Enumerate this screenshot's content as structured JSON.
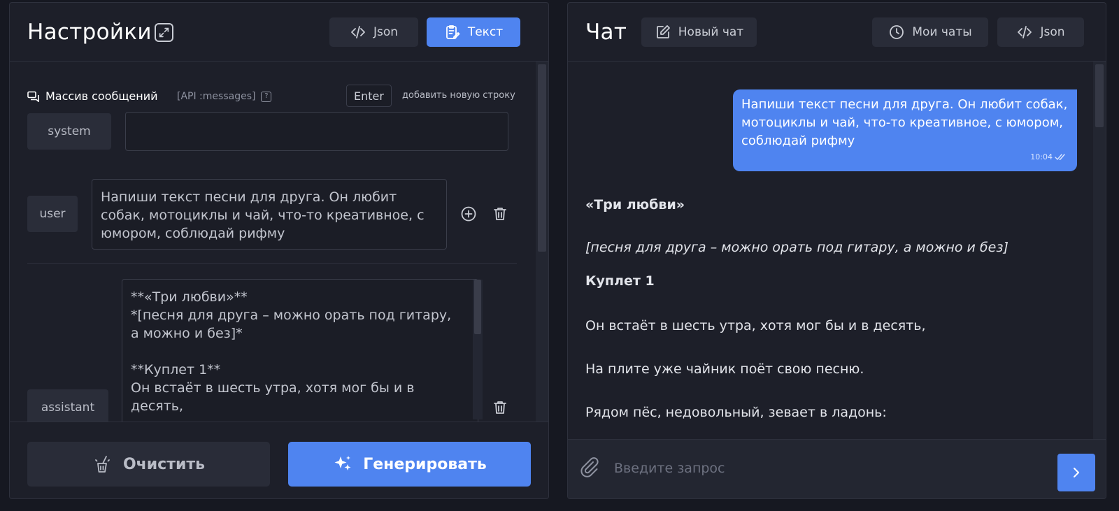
{
  "settings": {
    "title": "Настройки",
    "json_btn": "Json",
    "text_btn": "Текст",
    "messages_label": "Массив сообщений",
    "api_label": "[API :messages]",
    "help": "?",
    "enter_key": "Enter",
    "enter_hint": "добавить новую строку",
    "rows": [
      {
        "role": "system",
        "text": ""
      },
      {
        "role": "user",
        "text": "Напиши текст песни для друга. Он любит собак, мотоциклы и чай, что-то креативное, с юмором, соблюдай рифму"
      },
      {
        "role": "assistant",
        "text": "**«Три любви»**\n*[песня для друга – можно орать под гитару, а можно и без]*\n\n**Куплет 1**\nОн встаёт в шесть утра, хотя мог бы и в десять,"
      }
    ],
    "clear_btn": "Очистить",
    "generate_btn": "Генерировать"
  },
  "chat": {
    "title": "Чат",
    "new_chat_btn": "Новый чат",
    "my_chats_btn": "Мои чаты",
    "json_btn": "Json",
    "user_message": "Напиши текст песни для друга. Он любит собак, мотоциклы и чай, что-то креативное, с юмором, соблюдай рифму",
    "user_time": "10:04",
    "reply": {
      "title": "«Три любви»",
      "subtitle": "[песня для друга – можно орать под гитару, а можно и без]",
      "verse_heading": "Куплет 1",
      "lines": [
        "Он встаёт в шесть утра, хотя мог бы и в десять,",
        "На плите уже чайник поёт свою песню.",
        "Рядом пёс, недовольный, зевает в ладонь:"
      ]
    },
    "input_placeholder": "Введите запрос"
  },
  "colors": {
    "accent": "#4f84f0",
    "panel": "#1d1f29",
    "background": "#161821"
  }
}
